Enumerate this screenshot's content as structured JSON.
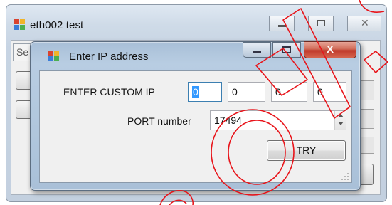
{
  "parent_window": {
    "title": "eth002 test",
    "tab_label": "Se",
    "controls": [
      "minimize-icon",
      "maximize-icon",
      "close-icon"
    ]
  },
  "dialog": {
    "title": "Enter IP address",
    "ip_label": "ENTER CUSTOM IP",
    "ip_octets": [
      "0",
      "0",
      "0",
      "0"
    ],
    "port_label": "PORT number",
    "port_value": "17494",
    "try_label": "TRY",
    "close_glyph": "X"
  },
  "colors": {
    "annotation": "#e8141a",
    "selection": "#3399ff",
    "close_button": "#c0392b"
  },
  "icons": {
    "app_icon": "window-app-icon",
    "grip": "resize-grip-icon",
    "spinner": "spinner-arrows-icon"
  }
}
